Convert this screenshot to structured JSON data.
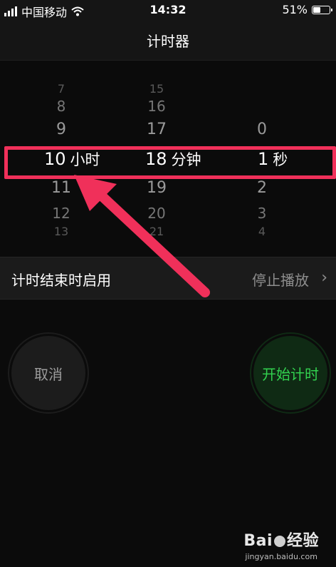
{
  "status_bar": {
    "carrier": "中国移动",
    "time": "14:32",
    "battery_percent": "51%",
    "battery_level": 0.51
  },
  "navbar": {
    "title": "计时器"
  },
  "picker": {
    "hours": {
      "above": [
        "7",
        "8",
        "9"
      ],
      "selected": "10",
      "below": [
        "11",
        "12",
        "13"
      ],
      "unit": "小时"
    },
    "minutes": {
      "above": [
        "15",
        "16",
        "17"
      ],
      "selected": "18",
      "below": [
        "19",
        "20",
        "21"
      ],
      "unit": "分钟"
    },
    "seconds": {
      "above": [
        "0"
      ],
      "selected": "1",
      "below": [
        "2",
        "3",
        "4"
      ],
      "unit": "秒"
    }
  },
  "option": {
    "label": "计时结束时启用",
    "value": "停止播放"
  },
  "buttons": {
    "cancel": "取消",
    "start": "开始计时"
  },
  "colors": {
    "annotation": "#f0305a",
    "start_green": "#32d14f",
    "background": "#0b0b0b"
  },
  "watermark": {
    "brand_a": "Bai",
    "brand_b": "经验",
    "site": "jingyan.baidu.com"
  }
}
